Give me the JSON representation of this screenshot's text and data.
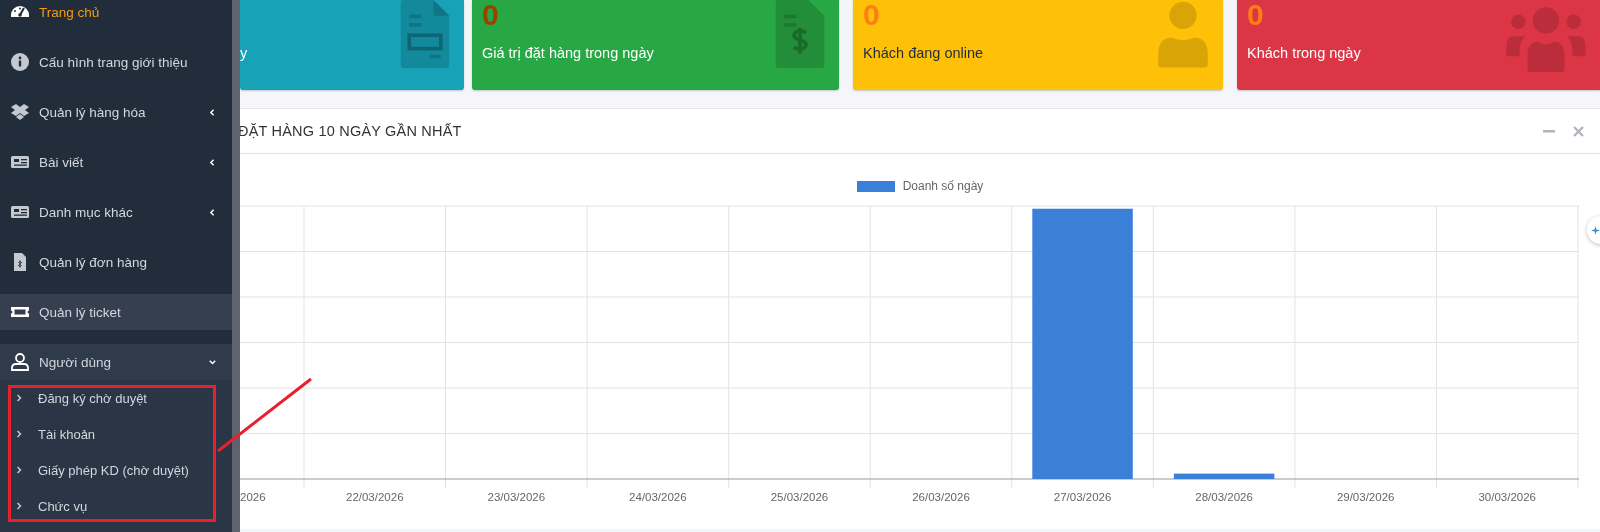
{
  "sidebar": {
    "items": [
      {
        "label": "Trang chủ",
        "selected": true,
        "highlighted": false
      },
      {
        "label": "Cấu hình trang giới thiệu",
        "selected": false,
        "highlighted": false
      },
      {
        "label": "Quản lý hàng hóa",
        "selected": false,
        "highlighted": false,
        "expanded": false
      },
      {
        "label": "Bài viết",
        "selected": false,
        "highlighted": false,
        "expanded": false
      },
      {
        "label": "Danh mục khác",
        "selected": false,
        "highlighted": false,
        "expanded": false
      },
      {
        "label": "Quản lý đơn hàng",
        "selected": false,
        "highlighted": false
      },
      {
        "label": "Quản lý ticket",
        "selected": false,
        "highlighted": true
      },
      {
        "label": "Người dùng",
        "selected": false,
        "highlighted": false,
        "expanded": true,
        "children": [
          {
            "label": "Đăng ký chờ duyệt"
          },
          {
            "label": "Tài khoản"
          },
          {
            "label": "Giấy phép KD (chờ duyệt)"
          },
          {
            "label": "Chức vụ"
          }
        ]
      }
    ]
  },
  "stat_cards": [
    {
      "label": "y",
      "color": "#17a2b8"
    },
    {
      "value": "0",
      "label": "Giá trị đặt hàng trong ngày",
      "color": "#28a745"
    },
    {
      "value": "0",
      "label": "Khách đang online",
      "color": "#ffc107"
    },
    {
      "value": "0",
      "label": "Khách trong ngày",
      "color": "#dc3545"
    }
  ],
  "chart_panel": {
    "title": "ĐẶT HÀNG 10 NGÀY GẦN NHẤT",
    "chart": {
      "categories": [
        "2026",
        "22/03/2026",
        "23/03/2026",
        "24/03/2026",
        "25/03/2026",
        "26/03/2026",
        "27/03/2026",
        "28/03/2026",
        "29/03/2026",
        "30/03/2026"
      ],
      "legend": {
        "name": "Doanh số ngày",
        "color": "#3b7fd9"
      }
    }
  }
}
